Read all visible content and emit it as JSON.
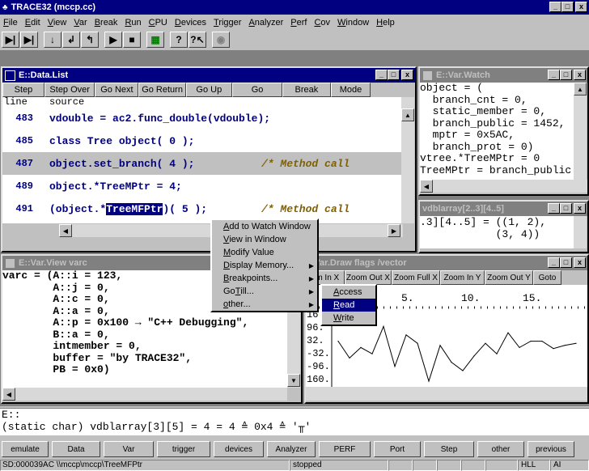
{
  "app": {
    "title": "TRACE32 (mccp.cc)"
  },
  "menubar": [
    "File",
    "Edit",
    "View",
    "Var",
    "Break",
    "Run",
    "CPU",
    "Devices",
    "Trigger",
    "Analyzer",
    "Perf",
    "Cov",
    "Window",
    "Help"
  ],
  "datalist": {
    "title": "E::Data.List",
    "buttons": [
      "Step",
      "Step Over",
      "Go Next",
      "Go Return",
      "Go Up",
      "Go",
      "Break",
      "Mode"
    ],
    "headers": {
      "line": "line",
      "source": "source"
    },
    "rows": [
      {
        "line": "483",
        "code": "vdouble = ac2.func_double(vdouble);",
        "comment": ""
      },
      {
        "line": "485",
        "code": "class Tree object( 0 );",
        "comment": ""
      },
      {
        "line": "487",
        "code": "object.set_branch( 4 );",
        "comment": "/* Method call"
      },
      {
        "line": "489",
        "code": "object.*TreeMPtr = 4;",
        "comment": ""
      },
      {
        "line": "491",
        "code": "(object.*",
        "sel": "TreeMFPtr",
        "after": ")( 5 );",
        "comment": "/* Method call"
      }
    ]
  },
  "varwatch": {
    "title": "E::Var.Watch",
    "lines": [
      "object = (",
      "  branch_cnt = 0,",
      "  static_member = 0,",
      "  branch_public = 1452,",
      "  mptr = 0x5AC,",
      "  branch_prot = 0)",
      "vtree.*TreeMPtr = 0",
      "TreeMPtr = branch_public"
    ]
  },
  "vdbl": {
    "title": "vdblarray[2..3][4..5]",
    "lines": [
      ".3][4..5] = ((1, 2),",
      "            (3, 4))"
    ]
  },
  "varview": {
    "title": "E::Var.View varc",
    "lines": [
      "varc = (A::i = 123,",
      "        A::j = 0,",
      "        A::c = 0,",
      "        A::a = 0,",
      "        A::p = 0x100 → \"C++ Debugging\",",
      "        B::a = 0,",
      "        intmember = 0,",
      "        buffer = \"by TRACE32\",",
      "        PB = 0x0)"
    ]
  },
  "draw": {
    "title": "::Var.Draw flags /vector",
    "buttons": [
      "om In X",
      "Zoom Out X",
      "Zoom Full X",
      "Zoom In Y",
      "Zoom Out Y",
      "Goto"
    ],
    "xticks": [
      "5.",
      "10.",
      "15."
    ],
    "yticks": [
      "16",
      "96.",
      "32.",
      "-32.",
      "-96.",
      "160."
    ]
  },
  "chart_data": {
    "type": "line",
    "values": [
      40,
      -40,
      10,
      -20,
      110,
      -80,
      70,
      30,
      -150,
      20,
      -60,
      -100,
      -30,
      30,
      -20,
      80,
      10,
      40,
      40,
      5,
      20,
      30
    ]
  },
  "contextmenu": {
    "items": [
      "Add to Watch Window",
      "View in Window",
      "Modify Value",
      "Display Memory...",
      "Breakpoints...",
      "Go Till...",
      "other..."
    ]
  },
  "submenu": {
    "items": [
      "Access",
      "Read",
      "Write"
    ]
  },
  "cmdline": {
    "prompt": "E::",
    "output": "(static char) vdblarray[3][5] = 4 = 4 ≙ 0x4 ≙ '╥'"
  },
  "softkeys": [
    "emulate",
    "Data",
    "Var",
    "trigger",
    "devices",
    "Analyzer",
    "PERF",
    "Port",
    "Step",
    "other",
    "previous"
  ],
  "statusbar": {
    "address": "SD:000039AC  \\\\mccp\\mccp\\TreeMFPtr",
    "state": "stopped",
    "mode": "HLL",
    "extra": "AI"
  }
}
